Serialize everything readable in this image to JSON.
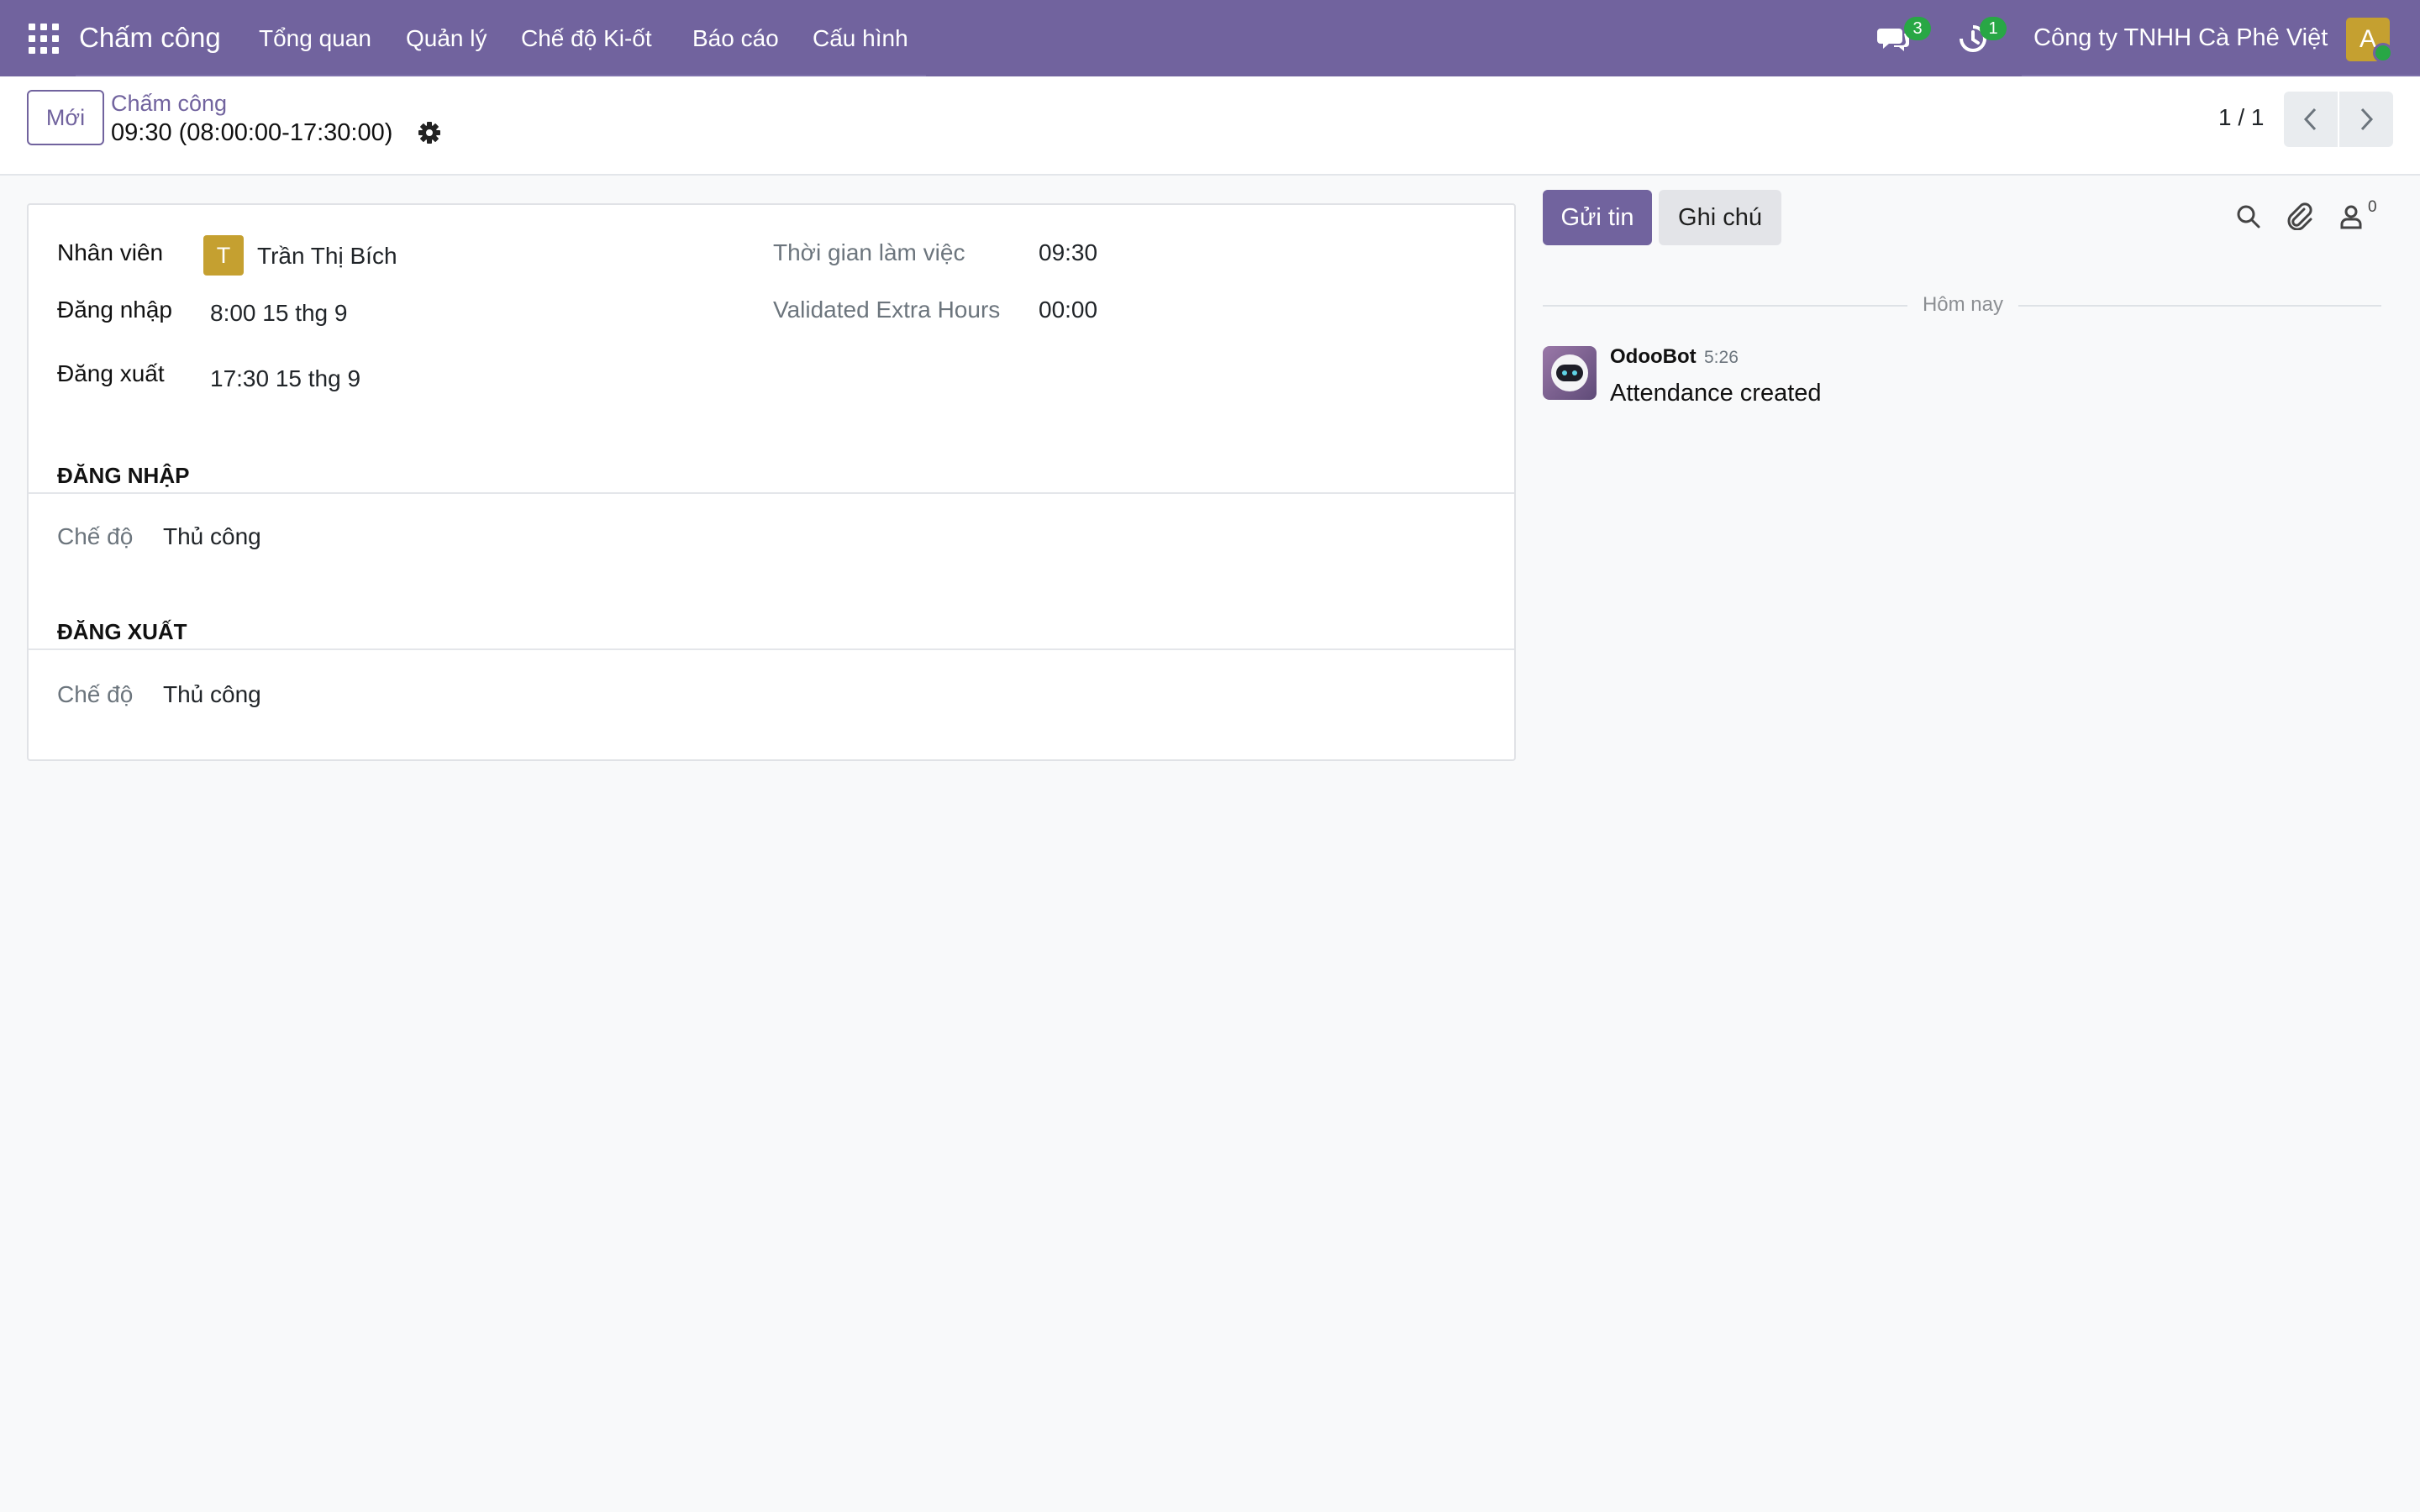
{
  "navbar": {
    "app_name": "Chấm công",
    "menu": [
      "Tổng quan",
      "Quản lý",
      "Chế độ Ki-ốt",
      "Báo cáo",
      "Cấu hình"
    ],
    "messages_count": "3",
    "activities_count": "1",
    "company": "Công ty TNHH Cà Phê Việt",
    "user_initial": "A"
  },
  "control_panel": {
    "new_label": "Mới",
    "breadcrumb": "Chấm công",
    "record_title": "09:30 (08:00:00-17:30:00)",
    "pager": "1 / 1"
  },
  "form": {
    "employee_label": "Nhân viên",
    "employee_initial": "T",
    "employee_name": "Trần Thị Bích",
    "check_in_label": "Đăng nhập",
    "check_in_value": "8:00 15 thg 9",
    "check_out_label": "Đăng xuất",
    "check_out_value": "17:30 15 thg 9",
    "worked_hours_label": "Thời gian làm việc",
    "worked_hours_value": "09:30",
    "extra_hours_label": "Validated Extra Hours",
    "extra_hours_value": "00:00",
    "section_check_in": "ĐĂNG NHẬP",
    "section_check_out": "ĐĂNG XUẤT",
    "mode_label": "Chế độ",
    "check_in_mode": "Thủ công",
    "check_out_mode": "Thủ công"
  },
  "chatter": {
    "send_message": "Gửi tin",
    "log_note": "Ghi chú",
    "followers_count": "0",
    "date_separator": "Hôm nay",
    "message": {
      "author": "OdooBot",
      "time": "5:26",
      "body": "Attendance created"
    }
  },
  "colors": {
    "brand": "#71639e",
    "badge": "#28a745",
    "avatar": "#c5a030"
  }
}
